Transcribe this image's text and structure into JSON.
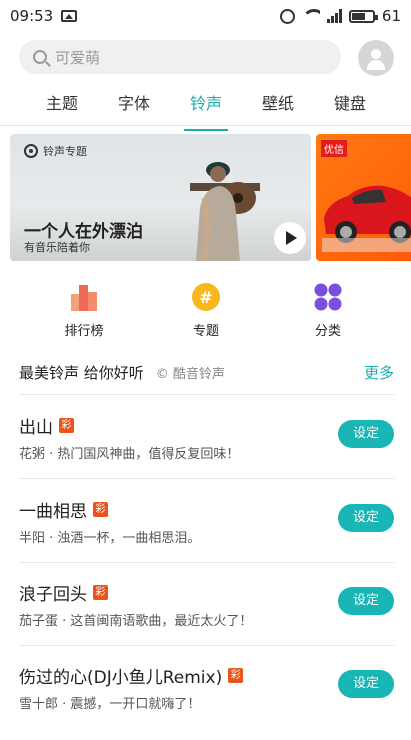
{
  "status_bar": {
    "time": "09:53",
    "battery": "61"
  },
  "search": {
    "placeholder": "可爱萌"
  },
  "tabs": [
    {
      "label": "主题",
      "active": false
    },
    {
      "label": "字体",
      "active": false
    },
    {
      "label": "铃声",
      "active": true
    },
    {
      "label": "壁纸",
      "active": false
    },
    {
      "label": "键盘",
      "active": false
    }
  ],
  "banner": {
    "tag": "铃声专题",
    "title": "一个人在外漂泊",
    "subtitle": "有音乐陪着你"
  },
  "banner2": {
    "logo": "优信"
  },
  "quick": [
    {
      "label": "排行榜",
      "icon": "ranking-icon"
    },
    {
      "label": "专题",
      "icon": "topic-hash-icon"
    },
    {
      "label": "分类",
      "icon": "category-icon"
    }
  ],
  "section": {
    "title": "最美铃声 给你好听",
    "credit": "© 酷音铃声",
    "more": "更多"
  },
  "ringtones": [
    {
      "name": "出山",
      "badge": "彩",
      "desc": "花粥 · 热门国风神曲，值得反复回味！",
      "button": "设定"
    },
    {
      "name": "一曲相思",
      "badge": "彩",
      "desc": "半阳 · 浊酒一杯，一曲相思泪。",
      "button": "设定"
    },
    {
      "name": "浪子回头",
      "badge": "彩",
      "desc": "茄子蛋 · 这首闽南语歌曲，最近太火了！",
      "button": "设定"
    },
    {
      "name": "伤过的心(DJ小鱼儿Remix)",
      "badge": "彩",
      "desc": "雪十郎 · 震撼，一开口就嗨了！",
      "button": "设定"
    }
  ],
  "colors": {
    "accent": "#1aaeae",
    "badge": "#e8551a"
  }
}
